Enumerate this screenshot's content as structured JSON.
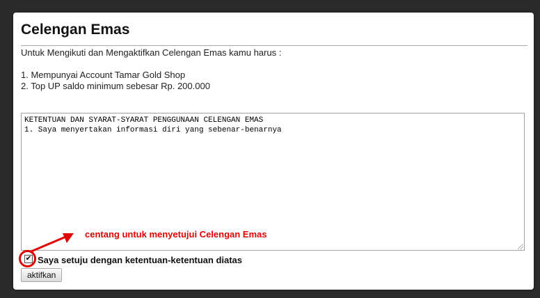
{
  "panel": {
    "title": "Celengan Emas",
    "intro": "Untuk Mengikuti dan Mengaktifkan Celengan Emas kamu harus :",
    "requirements": [
      "1. Mempunyai Account Tamar Gold Shop",
      "2. Top UP saldo minimum sebesar Rp. 200.000"
    ]
  },
  "terms": {
    "lines": [
      "KETENTUAN DAN SYARAT-SYARAT PENGGUNAAN CELENGAN EMAS",
      "1. Saya menyertakan informasi diri yang sebenar-benarnya"
    ]
  },
  "annotation": {
    "hint": "centang untuk menyetujui Celengan Emas",
    "color": "#e00000"
  },
  "agreement": {
    "checked": true,
    "check_glyph": "✔",
    "label": "Saya setuju dengan ketentuan-ketentuan diatas"
  },
  "actions": {
    "activate_label": "aktifkan"
  }
}
